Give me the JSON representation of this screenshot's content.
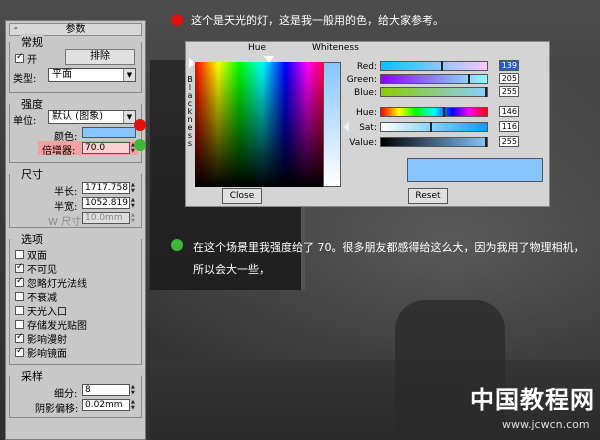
{
  "colors": {
    "red_dot": "#e01010",
    "green_dot": "#3fb53a",
    "light_color": "#87c5ff",
    "multiplier_highlight": "#f4a0a0"
  },
  "panel": {
    "title": "参数",
    "general": {
      "title": "常规",
      "on_label": "开",
      "exclude_label": "排除",
      "type_label": "类型:",
      "type_value": "平面"
    },
    "intensity": {
      "title": "强度",
      "units_label": "单位:",
      "units_value": "默认 (图象)",
      "color_label": "颜色:",
      "multiplier_label": "倍增器:",
      "multiplier_value": "70.0"
    },
    "size": {
      "title": "尺寸",
      "length_label": "半长:",
      "length_value": "1717.758",
      "width_label": "半宽:",
      "width_value": "1052.819",
      "wsize_label": "W 尺寸",
      "wsize_value": "10.0mm"
    },
    "options": {
      "title": "选项",
      "items": [
        {
          "label": "双面",
          "checked": false
        },
        {
          "label": "不可见",
          "checked": true
        },
        {
          "label": "忽略灯光法线",
          "checked": true
        },
        {
          "label": "不衰减",
          "checked": false
        },
        {
          "label": "天光入口",
          "checked": false
        },
        {
          "label": "存储发光贴图",
          "checked": false
        },
        {
          "label": "影响漫射",
          "checked": true
        },
        {
          "label": "影响镜面",
          "checked": true
        }
      ]
    },
    "sampling": {
      "title": "采样",
      "subdiv_label": "细分:",
      "subdiv_value": "8",
      "bias_label": "阴影偏移:",
      "bias_value": "0.02mm"
    }
  },
  "notes": {
    "note1": "这个是天光的灯，这是我一般用的色，给大家参考。",
    "note2": "在这个场景里我强度给了 70。很多朋友都感得给这么大，因为我用了物理相机，所以会大一些，"
  },
  "color_dialog": {
    "hue_label": "Hue",
    "whiteness_label": "Whiteness",
    "blackness_label": "B l a c k n e s s",
    "rows": [
      {
        "label": "Red:",
        "value": "139"
      },
      {
        "label": "Green:",
        "value": "205"
      },
      {
        "label": "Blue:",
        "value": "255"
      },
      {
        "label": "Hue:",
        "value": "146"
      },
      {
        "label": "Sat:",
        "value": "116"
      },
      {
        "label": "Value:",
        "value": "255"
      }
    ],
    "close_label": "Close",
    "reset_label": "Reset"
  },
  "watermark": {
    "title": "中国教程网",
    "url": "www.jcwcn.com"
  }
}
